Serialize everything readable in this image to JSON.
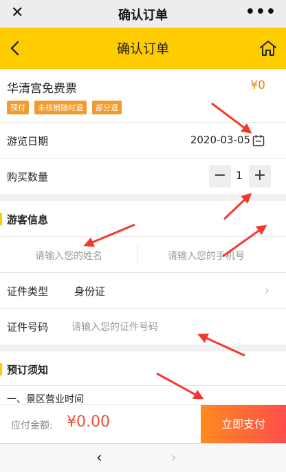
{
  "wechat": {
    "title": "确认订单",
    "close": "✕",
    "more": "•••"
  },
  "header": {
    "title": "确认订单"
  },
  "product": {
    "name": "华清宫免费票",
    "price": "¥0",
    "tags": [
      "预付",
      "未核销随时退",
      "部分退"
    ]
  },
  "date": {
    "label": "游览日期",
    "value": "2020-03-05"
  },
  "quantity": {
    "label": "购买数量",
    "minus": "−",
    "count": "1",
    "plus": "+"
  },
  "visitor": {
    "title": "游客信息",
    "name_placeholder": "请输入您的姓名",
    "phone_placeholder": "请输入您的手机号",
    "id_type_label": "证件类型",
    "id_type_value": "身份证",
    "id_number_label": "证件号码",
    "id_number_placeholder": "请输入您的证件号码"
  },
  "notice": {
    "title": "预订须知",
    "item1": "一、景区营业时间"
  },
  "footer": {
    "amount_label": "应付金额:",
    "amount": "¥0.00",
    "pay_button": "立即支付"
  },
  "nav": {
    "prev": "‹",
    "next": "›"
  },
  "colors": {
    "brand": "#ffcc00",
    "price": "#f08300",
    "tag": "#f39a2c",
    "amount": "#f04e3a",
    "annotation": "#f03a2e"
  }
}
